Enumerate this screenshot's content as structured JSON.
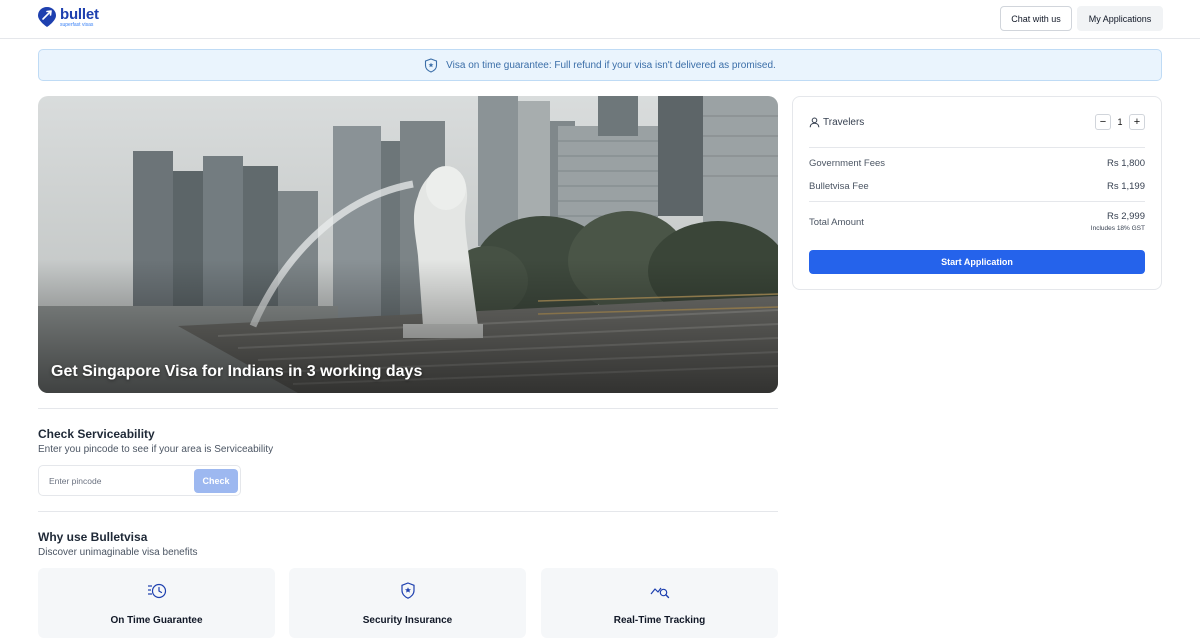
{
  "header": {
    "logo_name": "bullet",
    "logo_tagline": "superfast visas",
    "chat_label": "Chat with us",
    "apps_label": "My Applications"
  },
  "banner": {
    "text": "Visa on time guarantee: Full refund if your visa isn't delivered as promised.",
    "icon": "shield-star-icon"
  },
  "hero": {
    "title": "Get Singapore Visa for Indians in 3 working days"
  },
  "pricing": {
    "travelers_label": "Travelers",
    "traveler_count": "1",
    "minus": "−",
    "plus": "+",
    "government_fees_label": "Government Fees",
    "government_fees_value": "Rs 1,800",
    "bulletvisa_fee_label": "Bulletvisa Fee",
    "bulletvisa_fee_value": "Rs 1,199",
    "total_label": "Total Amount",
    "total_value": "Rs 2,999",
    "gst_note": "Includes 18% GST",
    "start_label": "Start Application"
  },
  "serviceability": {
    "title": "Check Serviceability",
    "subtitle": "Enter you pincode to see if your area is Serviceability",
    "placeholder": "Enter pincode",
    "check_label": "Check"
  },
  "why": {
    "title": "Why use Bulletvisa",
    "subtitle": "Discover unimaginable visa benefits",
    "benefits": [
      {
        "label": "On Time Guarantee",
        "icon": "clock-list-icon"
      },
      {
        "label": "Security Insurance",
        "icon": "shield-star-icon"
      },
      {
        "label": "Real-Time Tracking",
        "icon": "chart-search-icon"
      }
    ]
  },
  "colors": {
    "brand": "#1e40af",
    "primary_button": "#2563eb",
    "check_button": "#9db8f0",
    "banner_bg": "#eaf4fd"
  }
}
